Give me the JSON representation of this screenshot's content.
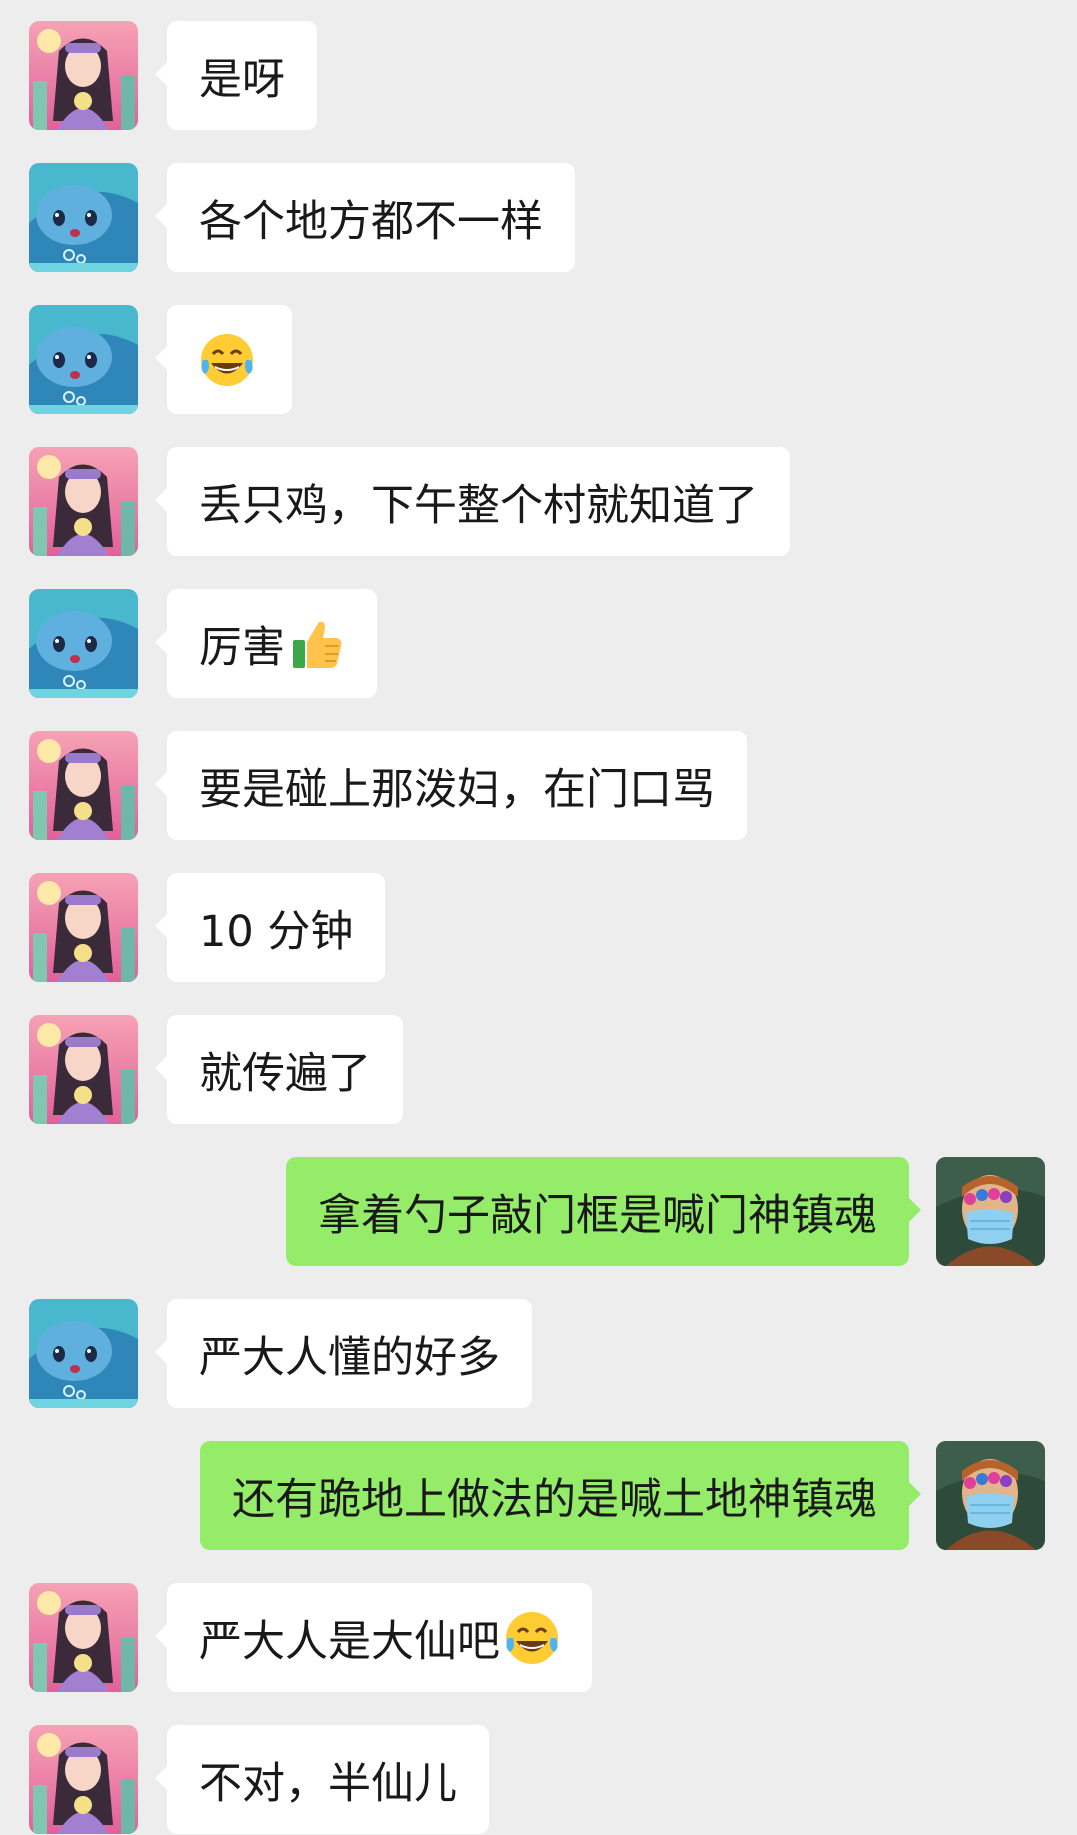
{
  "colors": {
    "background": "#ededed",
    "incoming_bubble": "#ffffff",
    "outgoing_bubble": "#95ec69",
    "text": "#191919"
  },
  "messages": [
    {
      "sender": "girl",
      "direction": "in",
      "text": "是呀",
      "emoji": ""
    },
    {
      "sender": "whale",
      "direction": "in",
      "text": "各个地方都不一样",
      "emoji": ""
    },
    {
      "sender": "whale",
      "direction": "in",
      "text": "",
      "emoji": "tears-of-joy-emoji"
    },
    {
      "sender": "girl",
      "direction": "in",
      "text": "丢只鸡，下午整个村就知道了",
      "emoji": ""
    },
    {
      "sender": "whale",
      "direction": "in",
      "text": "厉害",
      "emoji": "thumbs-up-emoji"
    },
    {
      "sender": "girl",
      "direction": "in",
      "text": "要是碰上那泼妇，在门口骂",
      "emoji": ""
    },
    {
      "sender": "girl",
      "direction": "in",
      "text": "10 分钟",
      "emoji": ""
    },
    {
      "sender": "girl",
      "direction": "in",
      "text": "就传遍了",
      "emoji": ""
    },
    {
      "sender": "me",
      "direction": "out",
      "text": "拿着勺子敲门框是喊门神镇魂",
      "emoji": ""
    },
    {
      "sender": "whale",
      "direction": "in",
      "text": "严大人懂的好多",
      "emoji": ""
    },
    {
      "sender": "me",
      "direction": "out",
      "text": "还有跪地上做法的是喊土地神镇魂",
      "emoji": ""
    },
    {
      "sender": "girl",
      "direction": "in",
      "text": "严大人是大仙吧",
      "emoji": "tears-of-joy-emoji"
    },
    {
      "sender": "girl",
      "direction": "in",
      "text": "不对，半仙儿",
      "emoji": ""
    }
  ]
}
